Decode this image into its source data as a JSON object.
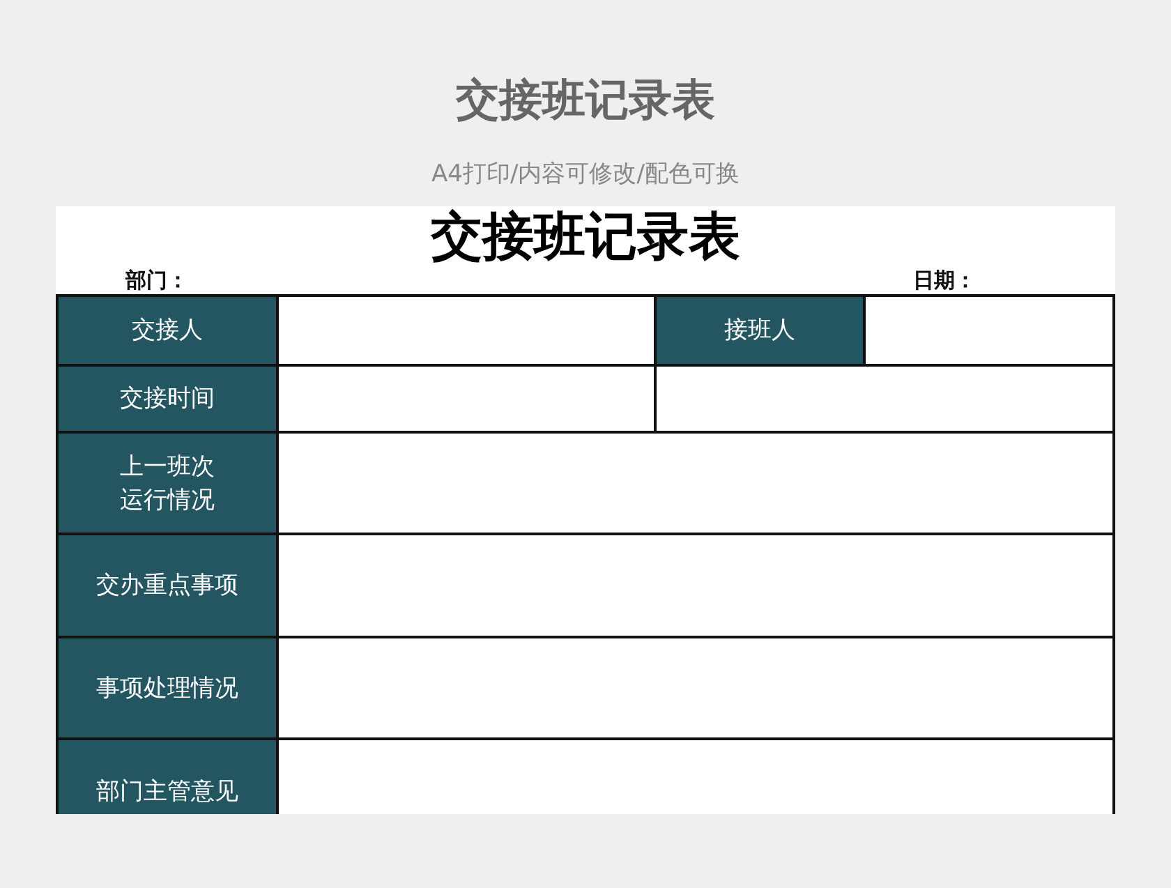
{
  "page_title": "交接班记录表",
  "subtitle": "A4打印/内容可修改/配色可换",
  "document": {
    "title": "交接班记录表",
    "department_label": "部门：",
    "date_label": "日期：",
    "rows": [
      {
        "kind": "pair",
        "label": "交接人",
        "second_label": "接班人"
      },
      {
        "kind": "split",
        "label": "交接时间"
      },
      {
        "kind": "full",
        "label_lines": [
          "上一班次",
          "运行情况"
        ]
      },
      {
        "kind": "full",
        "label": "交办重点事项"
      },
      {
        "kind": "full",
        "label": "事项处理情况"
      },
      {
        "kind": "full",
        "label": "部门主管意见"
      }
    ]
  }
}
